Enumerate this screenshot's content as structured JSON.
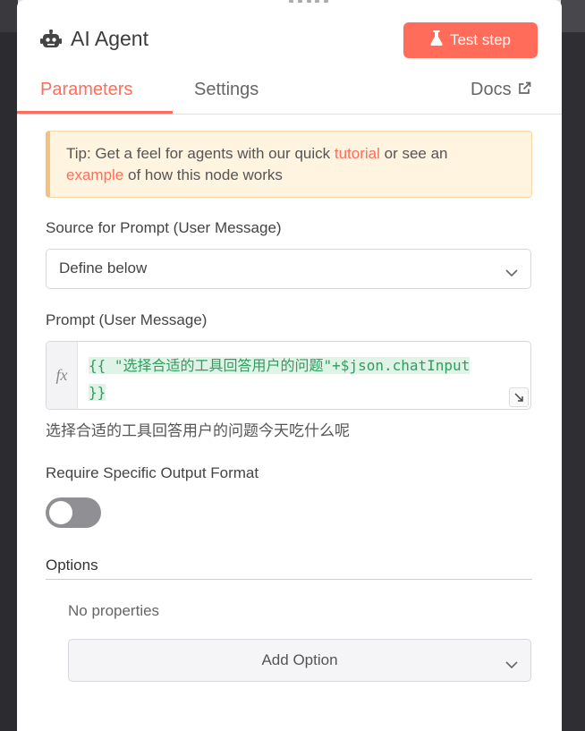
{
  "node": {
    "title": "AI Agent",
    "test_button": "Test step"
  },
  "tabs": {
    "parameters": "Parameters",
    "settings": "Settings",
    "docs": "Docs"
  },
  "tip": {
    "prefix": "Tip: Get a feel for agents with our quick ",
    "tutorial_link": "tutorial",
    "middle": " or see an",
    "example_link": "example",
    "suffix": " of how this node works"
  },
  "source": {
    "label": "Source for Prompt (User Message)",
    "value": "Define below"
  },
  "prompt": {
    "label": "Prompt (User Message)",
    "fx": "fx",
    "line1": "{{ \"选择合适的工具回答用户的问题\"+$json.chatInput",
    "line2": "}}",
    "preview": "选择合适的工具回答用户的问题今天吃什么呢"
  },
  "output_format": {
    "label": "Require Specific Output Format",
    "enabled": false
  },
  "options": {
    "label": "Options",
    "empty_text": "No properties",
    "add_button": "Add Option"
  },
  "colors": {
    "accent": "#ff6d5a",
    "tip_bg": "#fff4e0",
    "code_green": "#2e9e5f"
  },
  "icons": [
    "robot-icon",
    "flask-icon",
    "external-link-icon",
    "chevron-down-icon",
    "expand-icon"
  ]
}
